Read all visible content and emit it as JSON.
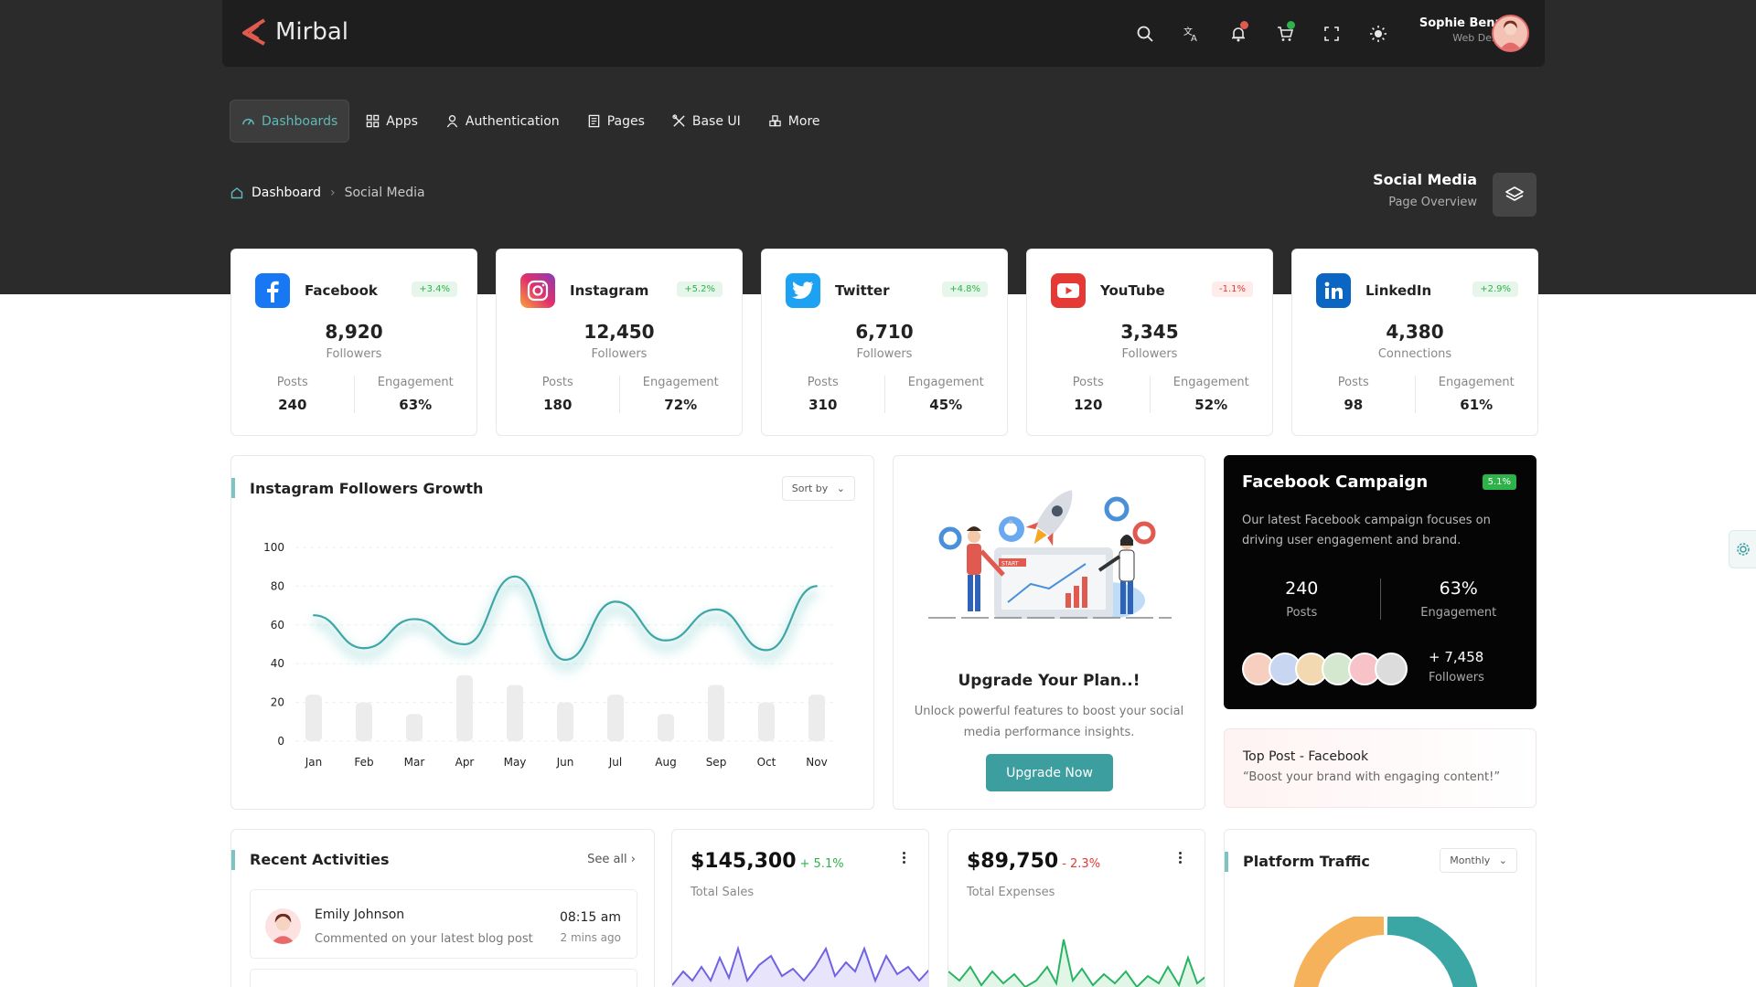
{
  "app": {
    "logo_text": "Mirbal"
  },
  "header": {
    "icons": [
      "search-icon",
      "translate-icon",
      "bell-icon",
      "cart-icon",
      "fullscreen-icon",
      "sun-icon"
    ],
    "user_name": "Sophie Bennett",
    "user_role": "Web Designer"
  },
  "nav": {
    "items": [
      {
        "label": "Dashboards",
        "icon": "gauge-icon",
        "active": true
      },
      {
        "label": "Apps",
        "icon": "grid-icon"
      },
      {
        "label": "Authentication",
        "icon": "user-icon"
      },
      {
        "label": "Pages",
        "icon": "document-icon"
      },
      {
        "label": "Base UI",
        "icon": "tools-icon"
      },
      {
        "label": "More",
        "icon": "cubes-icon"
      }
    ]
  },
  "breadcrumb": {
    "home": "Dashboard",
    "current": "Social Media"
  },
  "page_title": {
    "title": "Social Media",
    "subtitle": "Page Overview"
  },
  "socials": [
    {
      "name": "Facebook",
      "badge": "+3.4%",
      "value": "8,920",
      "unit": "Followers",
      "posts_label": "Posts",
      "posts": "240",
      "eng_label": "Engagement",
      "engagement": "63%",
      "color": "#1877f2"
    },
    {
      "name": "Instagram",
      "badge": "+5.2%",
      "value": "12,450",
      "unit": "Followers",
      "posts_label": "Posts",
      "posts": "180",
      "eng_label": "Engagement",
      "engagement": "72%",
      "color": "#e1306c"
    },
    {
      "name": "Twitter",
      "badge": "+4.8%",
      "value": "6,710",
      "unit": "Followers",
      "posts_label": "Posts",
      "posts": "310",
      "eng_label": "Engagement",
      "engagement": "45%",
      "color": "#1da1f2"
    },
    {
      "name": "YouTube",
      "badge": "-1.1%",
      "value": "3,345",
      "unit": "Followers",
      "posts_label": "Posts",
      "posts": "120",
      "eng_label": "Engagement",
      "engagement": "52%",
      "color": "#e53935"
    },
    {
      "name": "LinkedIn",
      "badge": "+2.9%",
      "value": "4,380",
      "unit": "Connections",
      "posts_label": "Posts",
      "posts": "98",
      "eng_label": "Engagement",
      "engagement": "61%",
      "color": "#0a66c2"
    }
  ],
  "growth": {
    "title": "Instagram Followers Growth",
    "sort_label": "Sort by"
  },
  "chart_data": {
    "type": "line",
    "title": "Instagram Followers Growth",
    "categories": [
      "Jan",
      "Feb",
      "Mar",
      "Apr",
      "May",
      "Jun",
      "Jul",
      "Aug",
      "Sep",
      "Oct",
      "Nov"
    ],
    "yticks": [
      "0",
      "20",
      "40",
      "60",
      "80",
      "100"
    ],
    "ylim": [
      0,
      100
    ],
    "series": [
      {
        "type": "line",
        "values": [
          65,
          48,
          63,
          50,
          85,
          42,
          72,
          52,
          68,
          47,
          80
        ]
      },
      {
        "type": "bar",
        "values": [
          24,
          20,
          14,
          34,
          29,
          20,
          24,
          14,
          29,
          20,
          24
        ]
      }
    ]
  },
  "upgrade": {
    "title": "Upgrade Your Plan..!",
    "text": "Unlock powerful features to boost your social media performance insights.",
    "button": "Upgrade Now",
    "art_text": "START"
  },
  "campaign": {
    "title": "Facebook Campaign",
    "badge": "5.1%",
    "desc": "Our latest Facebook campaign focuses on driving user engagement and brand.",
    "posts": "240",
    "posts_label": "Posts",
    "engagement": "63%",
    "eng_label": "Engagement",
    "followers": "+ 7,458",
    "followers_label": "Followers"
  },
  "top_post": {
    "title": "Top Post - Facebook",
    "quote": "“Boost your brand with engaging content!”"
  },
  "activities": {
    "title": "Recent Activities",
    "see_all": "See all",
    "items": [
      {
        "name": "Emily Johnson",
        "desc": "Commented on your latest blog post",
        "time": "08:15 am",
        "ago": "2 mins ago"
      }
    ]
  },
  "sales": {
    "value": "$145,300",
    "change": "+ 5.1%",
    "label": "Total Sales",
    "color": "#6f62e3"
  },
  "expenses": {
    "value": "$89,750",
    "change": "- 2.3%",
    "label": "Total Expenses",
    "color": "#28b463"
  },
  "traffic": {
    "title": "Platform Traffic",
    "period": "Monthly"
  },
  "colors": {
    "accent": "#3c9e9e",
    "positive": "#2db34a",
    "negative": "#e53935",
    "donut_a": "#f5b25a",
    "donut_b": "#3aa7a4"
  }
}
